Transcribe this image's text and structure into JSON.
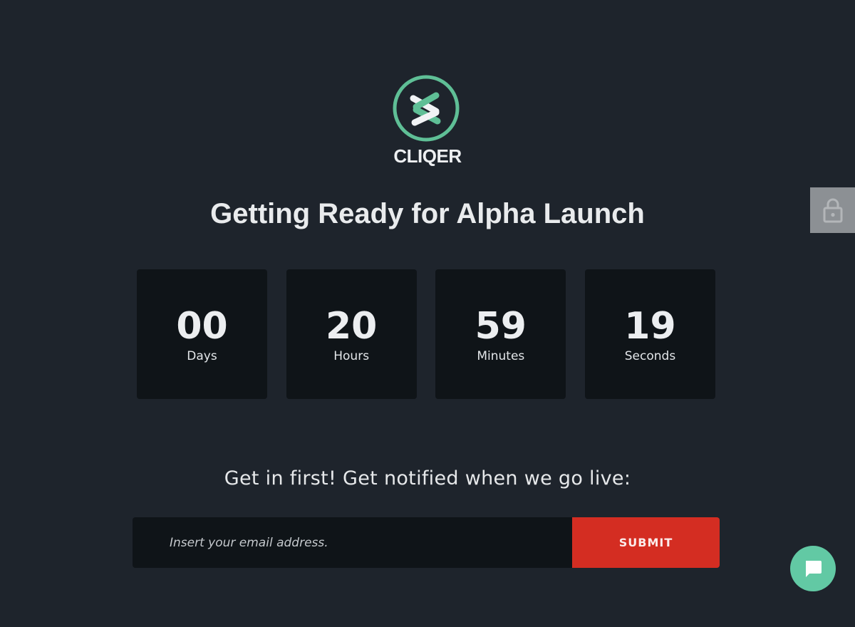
{
  "brand": {
    "name": "CLIQER",
    "accent_color": "#5fbf96"
  },
  "headline": "Getting Ready for Alpha Launch",
  "countdown": [
    {
      "value": "00",
      "unit": "Days"
    },
    {
      "value": "20",
      "unit": "Hours"
    },
    {
      "value": "59",
      "unit": "Minutes"
    },
    {
      "value": "19",
      "unit": "Seconds"
    }
  ],
  "notify": {
    "text": "Get in first! Get notified when we go live:",
    "email_placeholder": "Insert your email address.",
    "submit_label": "SUBMIT",
    "submit_color": "#d42d22"
  },
  "widgets": {
    "lock_icon": "lock-icon",
    "chat_icon": "chat-bubble-icon",
    "chat_color": "#62c9a4"
  }
}
